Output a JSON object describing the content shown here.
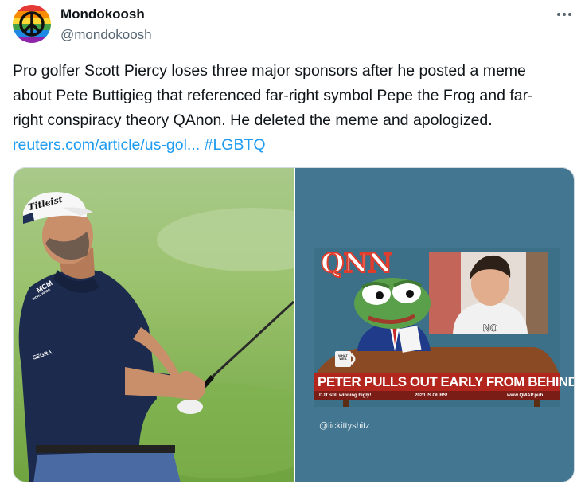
{
  "author": {
    "display_name": "Mondokoosh",
    "handle": "@mondokoosh",
    "avatar_icon": "rainbow-peace-sign-icon"
  },
  "more_options_icon": "more-horizontal-icon",
  "tweet": {
    "text": "Pro golfer Scott Piercy loses three major sponsors after he posted a meme about Pete Buttigieg that referenced far-right symbol Pepe the Frog and far-right conspiracy theory QAnon. He deleted the meme and apologized. ",
    "link": "reuters.com/article/us-gol...",
    "hashtag": "#LGBTQ"
  },
  "media": {
    "left_photo": {
      "cap_brand": "Titleist",
      "shirt_logo": "MCM",
      "shirt_logo_sub": "WORLDWIDE",
      "sleeve_logo": "SEGRA"
    },
    "meme": {
      "network_logo": "QNN",
      "mug_text": "WHAT WEA",
      "inset_label": "NO",
      "headline": "PETER PULLS OUT EARLY FROM BEHIND",
      "ticker_left": "DJT still winning bigly!",
      "ticker_center": "2020 IS OURS!",
      "ticker_right": "www.QMAP.pub",
      "credit": "@lickittyshitz"
    }
  },
  "colors": {
    "link": "#1d9bf0",
    "meme_background": "#437691",
    "headline_banner": "#b3261e",
    "desk": "#8a4a24"
  }
}
